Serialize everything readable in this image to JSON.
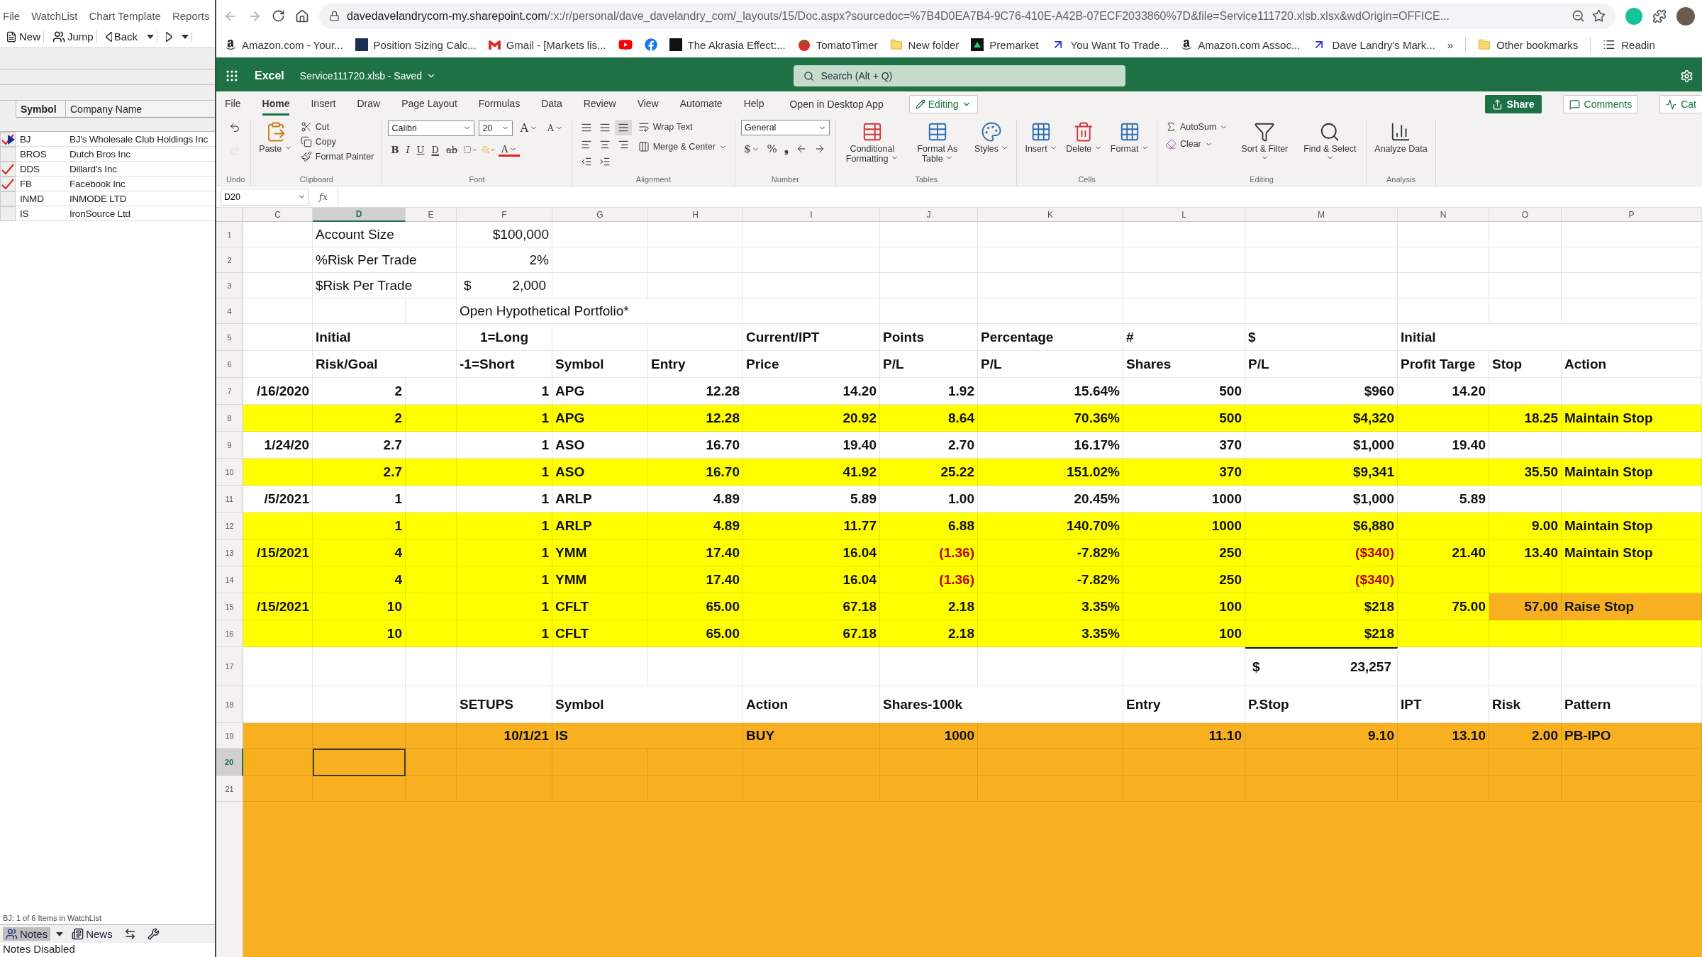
{
  "watchlist": {
    "menu": [
      "File",
      "WatchList",
      "Chart Template",
      "Reports"
    ],
    "toolbar": [
      {
        "kind": "new",
        "label": "New"
      },
      {
        "kind": "jump",
        "label": "Jump"
      },
      {
        "kind": "back",
        "label": "Back"
      },
      {
        "kind": "forward"
      }
    ],
    "columns": [
      "Symbol",
      "Company Name"
    ],
    "rows": [
      {
        "symbol": "BJ",
        "company": "BJ's Wholesale Club Holdings Inc",
        "checked": true,
        "selected": true
      },
      {
        "symbol": "BROS",
        "company": "Dutch Bros Inc",
        "checked": false,
        "selected": false
      },
      {
        "symbol": "DDS",
        "company": "Dillard's Inc",
        "checked": true,
        "selected": false
      },
      {
        "symbol": "FB",
        "company": "Facebook Inc",
        "checked": true,
        "selected": false
      },
      {
        "symbol": "INMD",
        "company": "INMODE LTD",
        "checked": false,
        "selected": false
      },
      {
        "symbol": "IS",
        "company": "IronSource Ltd",
        "checked": false,
        "selected": false
      }
    ],
    "status": "BJ: 1 of 6 Items in WatchList",
    "bottom_toolbar": [
      {
        "kind": "notes",
        "label": "Notes",
        "selected": true
      },
      {
        "kind": "news",
        "label": "News",
        "selected": false
      },
      {
        "kind": "swap",
        "selected": false
      },
      {
        "kind": "tool",
        "selected": false
      }
    ],
    "notes_message": "Notes Disabled"
  },
  "browser": {
    "url_host": "davedavelandrycom-my.sharepoint.com",
    "url_path": "/:x:/r/personal/dave_davelandry_com/_layouts/15/Doc.aspx?sourcedoc=%7B4D0EA7B4-9C76-410E-A42B-07ECF2033860%7D&file=Service111720.xlsb.xlsx&wdOrigin=OFFICE...",
    "bookmarks": [
      {
        "kind": "amazon",
        "label": "Amazon.com - Your..."
      },
      {
        "kind": "square",
        "label": "Position Sizing Calc..."
      },
      {
        "kind": "gmail",
        "label": "Gmail - [Markets lis..."
      },
      {
        "kind": "youtube"
      },
      {
        "kind": "facebook"
      },
      {
        "kind": "black",
        "label": "The Akrasia Effect:..."
      },
      {
        "kind": "tomato",
        "label": "TomatoTimer"
      },
      {
        "kind": "folder",
        "label": "New folder"
      },
      {
        "kind": "premarket",
        "label": "Premarket"
      },
      {
        "kind": "arrow",
        "label": "You Want To Trade..."
      },
      {
        "kind": "amazon",
        "label": "Amazon.com Assoc..."
      },
      {
        "kind": "arrow",
        "label": "Dave Landry's Mark..."
      }
    ],
    "more": "»",
    "other_bookmarks": "Other bookmarks",
    "reading_list": "Readin"
  },
  "excel": {
    "app": "Excel",
    "file": "Service111720.xlsb - Saved",
    "search_placeholder": "Search (Alt + Q)",
    "tabs": [
      {
        "label": "File",
        "selected": false
      },
      {
        "label": "Home",
        "selected": true
      },
      {
        "label": "Insert",
        "selected": false
      },
      {
        "label": "Draw",
        "selected": false
      },
      {
        "label": "Page Layout",
        "selected": false
      },
      {
        "label": "Formulas",
        "selected": false
      },
      {
        "label": "Data",
        "selected": false
      },
      {
        "label": "Review",
        "selected": false
      },
      {
        "label": "View",
        "selected": false
      },
      {
        "label": "Automate",
        "selected": false
      },
      {
        "label": "Help",
        "selected": false
      }
    ],
    "open_desktop": "Open in Desktop App",
    "mode": "Editing",
    "share": "Share",
    "comments": "Comments",
    "catch_up": "Cat",
    "groups": [
      {
        "label": "Undo",
        "controls": [
          {
            "kind": "icon",
            "disabled": false
          },
          {
            "kind": "icon",
            "disabled": true
          }
        ]
      },
      {
        "label": "Clipboard",
        "controls": [
          {
            "kind": "large",
            "label": "Paste"
          },
          {
            "kind": "small",
            "label": "Cut"
          },
          {
            "kind": "small",
            "label": "Copy"
          },
          {
            "kind": "small",
            "label": "Format Painter"
          }
        ]
      },
      {
        "label": "Font",
        "controls": [
          {
            "kind": "field",
            "value": "Calibri"
          },
          {
            "kind": "field",
            "value": "20"
          },
          {
            "kind": "glyph",
            "label": "A"
          },
          {
            "kind": "glyph",
            "label": "A"
          },
          {
            "kind": "glyph",
            "label": "B"
          },
          {
            "kind": "glyph",
            "label": "I"
          },
          {
            "kind": "glyph",
            "label": "U"
          },
          {
            "kind": "glyph",
            "label": "D"
          },
          {
            "kind": "glyph",
            "label": "ab"
          },
          {
            "kind": "icon"
          },
          {
            "kind": "icon"
          },
          {
            "kind": "glyph",
            "label": "A"
          }
        ]
      },
      {
        "label": "Alignment",
        "controls": [
          {
            "kind": "icon",
            "selected": false
          },
          {
            "kind": "icon",
            "selected": false
          },
          {
            "kind": "icon",
            "selected": true
          },
          {
            "kind": "icon"
          },
          {
            "kind": "icon"
          },
          {
            "kind": "icon"
          },
          {
            "kind": "icon"
          },
          {
            "kind": "icon"
          },
          {
            "kind": "small",
            "label": "Wrap Text"
          },
          {
            "kind": "small",
            "label": "Merge & Center"
          }
        ]
      },
      {
        "label": "Number",
        "controls": [
          {
            "kind": "field",
            "value": "General"
          },
          {
            "kind": "glyph",
            "label": "$"
          },
          {
            "kind": "glyph",
            "label": "%"
          },
          {
            "kind": "glyph",
            "label": "❟"
          },
          {
            "kind": "icon"
          },
          {
            "kind": "icon"
          }
        ]
      },
      {
        "label": "Tables",
        "controls": [
          {
            "kind": "large",
            "label": "Conditional Formatting"
          },
          {
            "kind": "large",
            "label": "Format As Table"
          },
          {
            "kind": "large",
            "label": "Styles"
          }
        ]
      },
      {
        "label": "Cells",
        "controls": [
          {
            "kind": "large",
            "label": "Insert"
          },
          {
            "kind": "large",
            "label": "Delete"
          },
          {
            "kind": "large",
            "label": "Format"
          }
        ]
      },
      {
        "label": "Editing",
        "controls": [
          {
            "kind": "small",
            "label": "AutoSum"
          },
          {
            "kind": "small",
            "label": "Clear"
          },
          {
            "kind": "large",
            "label": "Sort & Filter"
          },
          {
            "kind": "large",
            "label": "Find & Select"
          }
        ]
      },
      {
        "label": "Analysis",
        "controls": [
          {
            "kind": "large",
            "label": "Analyze Data"
          }
        ]
      }
    ],
    "name_box": "D20",
    "fx": "fx"
  },
  "sheet": {
    "columns": [
      {
        "letter": "C",
        "selected": false
      },
      {
        "letter": "D",
        "selected": true
      },
      {
        "letter": "E",
        "selected": false
      },
      {
        "letter": "F",
        "selected": false
      },
      {
        "letter": "G",
        "selected": false
      },
      {
        "letter": "H",
        "selected": false
      },
      {
        "letter": "I",
        "selected": false
      },
      {
        "letter": "J",
        "selected": false
      },
      {
        "letter": "K",
        "selected": false
      },
      {
        "letter": "L",
        "selected": false
      },
      {
        "letter": "M",
        "selected": false
      },
      {
        "letter": "N",
        "selected": false
      },
      {
        "letter": "O",
        "selected": false
      },
      {
        "letter": "P",
        "selected": false
      }
    ],
    "rows": [
      {
        "number": "1",
        "color": "#ffffff",
        "bold": false,
        "selected": false,
        "cells": [
          null,
          {
            "kind": "text",
            "text": "Account Size"
          },
          null,
          {
            "kind": "number",
            "text": "$100,000"
          },
          null,
          null,
          null,
          null,
          null,
          null,
          null,
          null,
          null,
          null
        ]
      },
      {
        "number": "2",
        "color": "#ffffff",
        "bold": false,
        "selected": false,
        "cells": [
          null,
          {
            "kind": "text",
            "text": "%Risk Per Trade"
          },
          null,
          {
            "kind": "number",
            "text": "2%"
          },
          null,
          null,
          null,
          null,
          null,
          null,
          null,
          null,
          null,
          null
        ]
      },
      {
        "number": "3",
        "color": "#ffffff",
        "bold": false,
        "selected": false,
        "cells": [
          null,
          {
            "kind": "text",
            "text": "$Risk Per Trade"
          },
          null,
          {
            "kind": "accounting",
            "symbol": "$",
            "text": "2,000"
          },
          null,
          null,
          null,
          null,
          null,
          null,
          null,
          null,
          null,
          null
        ]
      },
      {
        "number": "4",
        "color": "#ffffff",
        "bold": false,
        "selected": false,
        "cells": [
          null,
          null,
          null,
          {
            "kind": "text",
            "text": "Open Hypothetical Portfolio*"
          },
          null,
          null,
          null,
          null,
          null,
          null,
          null,
          null,
          null,
          null
        ]
      },
      {
        "number": "5",
        "color": "#ffffff",
        "bold": true,
        "selected": false,
        "cells": [
          null,
          {
            "kind": "text",
            "text": "Initial"
          },
          null,
          {
            "kind": "center",
            "text": "1=Long"
          },
          null,
          null,
          {
            "kind": "text",
            "text": "Current/IPT"
          },
          {
            "kind": "text",
            "text": "Points"
          },
          {
            "kind": "text",
            "text": "Percentage"
          },
          {
            "kind": "text",
            "text": "#"
          },
          {
            "kind": "text",
            "text": "$"
          },
          {
            "kind": "text",
            "text": "Initial"
          },
          null,
          null
        ]
      },
      {
        "number": "6",
        "color": "#ffffff",
        "bold": true,
        "selected": false,
        "cells": [
          null,
          {
            "kind": "text",
            "text": "Risk/Goal"
          },
          null,
          {
            "kind": "text",
            "text": "-1=Short"
          },
          {
            "kind": "text",
            "text": "Symbol"
          },
          {
            "kind": "text",
            "text": "Entry"
          },
          {
            "kind": "text",
            "text": "Price"
          },
          {
            "kind": "text",
            "text": "P/L"
          },
          {
            "kind": "text",
            "text": "P/L"
          },
          {
            "kind": "text",
            "text": "Shares"
          },
          {
            "kind": "text",
            "text": "P/L"
          },
          {
            "kind": "text",
            "text": "Profit Targe"
          },
          {
            "kind": "text",
            "text": "Stop"
          },
          {
            "kind": "text",
            "text": "Action"
          }
        ]
      },
      {
        "number": "7",
        "color": "#ffffff",
        "bold": true,
        "selected": false,
        "cells": [
          {
            "kind": "number",
            "text": "/16/2020"
          },
          {
            "kind": "number",
            "text": "2"
          },
          null,
          {
            "kind": "number",
            "text": "1"
          },
          {
            "kind": "text",
            "text": "APG"
          },
          {
            "kind": "number",
            "text": "12.28"
          },
          {
            "kind": "number",
            "text": "14.20"
          },
          {
            "kind": "number",
            "text": "1.92"
          },
          {
            "kind": "number",
            "text": "15.64%"
          },
          {
            "kind": "number",
            "text": "500"
          },
          {
            "kind": "number",
            "text": "$960"
          },
          {
            "kind": "number",
            "text": "14.20"
          },
          null,
          null
        ]
      },
      {
        "number": "8",
        "color": "#ffff00",
        "bold": true,
        "selected": false,
        "cells": [
          null,
          {
            "kind": "number",
            "text": "2"
          },
          null,
          {
            "kind": "number",
            "text": "1"
          },
          {
            "kind": "text",
            "text": "APG"
          },
          {
            "kind": "number",
            "text": "12.28"
          },
          {
            "kind": "number",
            "text": "20.92"
          },
          {
            "kind": "number",
            "text": "8.64"
          },
          {
            "kind": "number",
            "text": "70.36%"
          },
          {
            "kind": "number",
            "text": "500"
          },
          {
            "kind": "number",
            "text": "$4,320"
          },
          null,
          {
            "kind": "number",
            "text": "18.25"
          },
          {
            "kind": "text",
            "text": "Maintain Stop"
          }
        ]
      },
      {
        "number": "9",
        "color": "#ffffff",
        "bold": true,
        "selected": false,
        "cells": [
          {
            "kind": "number",
            "text": "1/24/20"
          },
          {
            "kind": "number",
            "text": "2.7"
          },
          null,
          {
            "kind": "number",
            "text": "1"
          },
          {
            "kind": "text",
            "text": "ASO"
          },
          {
            "kind": "number",
            "text": "16.70"
          },
          {
            "kind": "number",
            "text": "19.40"
          },
          {
            "kind": "number",
            "text": "2.70"
          },
          {
            "kind": "number",
            "text": "16.17%"
          },
          {
            "kind": "number",
            "text": "370"
          },
          {
            "kind": "number",
            "text": "$1,000"
          },
          {
            "kind": "number",
            "text": "19.40"
          },
          null,
          null
        ]
      },
      {
        "number": "10",
        "color": "#ffff00",
        "bold": true,
        "selected": false,
        "cells": [
          null,
          {
            "kind": "number",
            "text": "2.7"
          },
          null,
          {
            "kind": "number",
            "text": "1"
          },
          {
            "kind": "text",
            "text": "ASO"
          },
          {
            "kind": "number",
            "text": "16.70"
          },
          {
            "kind": "number",
            "text": "41.92"
          },
          {
            "kind": "number",
            "text": "25.22"
          },
          {
            "kind": "number",
            "text": "151.02%"
          },
          {
            "kind": "number",
            "text": "370"
          },
          {
            "kind": "number",
            "text": "$9,341"
          },
          null,
          {
            "kind": "number",
            "text": "35.50"
          },
          {
            "kind": "text",
            "text": "Maintain Stop"
          }
        ]
      },
      {
        "number": "11",
        "color": "#ffffff",
        "bold": true,
        "selected": false,
        "cells": [
          {
            "kind": "number",
            "text": "/5/2021"
          },
          {
            "kind": "number",
            "text": "1"
          },
          null,
          {
            "kind": "number",
            "text": "1"
          },
          {
            "kind": "text",
            "text": "ARLP"
          },
          {
            "kind": "number",
            "text": "4.89"
          },
          {
            "kind": "number",
            "text": "5.89"
          },
          {
            "kind": "number",
            "text": "1.00"
          },
          {
            "kind": "number",
            "text": "20.45%"
          },
          {
            "kind": "number",
            "text": "1000"
          },
          {
            "kind": "number",
            "text": "$1,000"
          },
          {
            "kind": "number",
            "text": "5.89"
          },
          null,
          null
        ]
      },
      {
        "number": "12",
        "color": "#ffff00",
        "bold": true,
        "selected": false,
        "cells": [
          null,
          {
            "kind": "number",
            "text": "1"
          },
          null,
          {
            "kind": "number",
            "text": "1"
          },
          {
            "kind": "text",
            "text": "ARLP"
          },
          {
            "kind": "number",
            "text": "4.89"
          },
          {
            "kind": "number",
            "text": "11.77"
          },
          {
            "kind": "number",
            "text": "6.88"
          },
          {
            "kind": "number",
            "text": "140.70%"
          },
          {
            "kind": "number",
            "text": "1000"
          },
          {
            "kind": "number",
            "text": "$6,880"
          },
          null,
          {
            "kind": "number",
            "text": "9.00"
          },
          {
            "kind": "text",
            "text": "Maintain Stop"
          }
        ]
      },
      {
        "number": "13",
        "color": "#ffff00",
        "bold": true,
        "selected": false,
        "cells": [
          {
            "kind": "number",
            "text": "/15/2021"
          },
          {
            "kind": "number",
            "text": "4"
          },
          null,
          {
            "kind": "number",
            "text": "1"
          },
          {
            "kind": "text",
            "text": "YMM"
          },
          {
            "kind": "number",
            "text": "17.40"
          },
          {
            "kind": "number",
            "text": "16.04"
          },
          {
            "kind": "negative",
            "text": "(1.36)"
          },
          {
            "kind": "number",
            "text": "-7.82%"
          },
          {
            "kind": "number",
            "text": "250"
          },
          {
            "kind": "negative",
            "text": "($340)"
          },
          {
            "kind": "number",
            "text": "21.40"
          },
          {
            "kind": "number",
            "text": "13.40"
          },
          {
            "kind": "text",
            "text": "Maintain Stop"
          }
        ]
      },
      {
        "number": "14",
        "color": "#ffff00",
        "bold": true,
        "selected": false,
        "cells": [
          null,
          {
            "kind": "number",
            "text": "4"
          },
          null,
          {
            "kind": "number",
            "text": "1"
          },
          {
            "kind": "text",
            "text": "YMM"
          },
          {
            "kind": "number",
            "text": "17.40"
          },
          {
            "kind": "number",
            "text": "16.04"
          },
          {
            "kind": "negative",
            "text": "(1.36)"
          },
          {
            "kind": "number",
            "text": "-7.82%"
          },
          {
            "kind": "number",
            "text": "250"
          },
          {
            "kind": "negative",
            "text": "($340)"
          },
          null,
          null,
          null
        ]
      },
      {
        "number": "15",
        "color": "#ffff00",
        "bold": true,
        "selected": false,
        "cells": [
          {
            "kind": "number",
            "text": "/15/2021"
          },
          {
            "kind": "number",
            "text": "10"
          },
          null,
          {
            "kind": "number",
            "text": "1"
          },
          {
            "kind": "text",
            "text": "CFLT"
          },
          {
            "kind": "number",
            "text": "65.00"
          },
          {
            "kind": "number",
            "text": "67.18"
          },
          {
            "kind": "number",
            "text": "2.18"
          },
          {
            "kind": "number",
            "text": "3.35%"
          },
          {
            "kind": "number",
            "text": "100"
          },
          {
            "kind": "number",
            "text": "$218"
          },
          {
            "kind": "number",
            "text": "75.00"
          },
          {
            "kind": "number",
            "text": "57.00",
            "color": "#f8b020"
          },
          {
            "kind": "text",
            "text": "Raise Stop",
            "color": "#f8b020"
          }
        ]
      },
      {
        "number": "16",
        "color": "#ffff00",
        "bold": true,
        "selected": false,
        "cells": [
          null,
          {
            "kind": "number",
            "text": "10"
          },
          null,
          {
            "kind": "number",
            "text": "1"
          },
          {
            "kind": "text",
            "text": "CFLT"
          },
          {
            "kind": "number",
            "text": "65.00"
          },
          {
            "kind": "number",
            "text": "67.18"
          },
          {
            "kind": "number",
            "text": "2.18"
          },
          {
            "kind": "number",
            "text": "3.35%"
          },
          {
            "kind": "number",
            "text": "100"
          },
          {
            "kind": "number",
            "text": "$218"
          },
          null,
          null,
          null
        ]
      },
      {
        "number": "17",
        "color": "#ffffff",
        "bold": true,
        "selected": false,
        "cells": [
          null,
          null,
          null,
          null,
          null,
          null,
          null,
          null,
          null,
          null,
          {
            "kind": "total",
            "symbol": "$",
            "text": "23,257"
          },
          null,
          null,
          null
        ]
      },
      {
        "number": "18",
        "color": "#ffffff",
        "bold": true,
        "selected": false,
        "cells": [
          null,
          null,
          null,
          {
            "kind": "text",
            "text": "SETUPS"
          },
          {
            "kind": "text",
            "text": "Symbol"
          },
          null,
          {
            "kind": "text",
            "text": "Action"
          },
          {
            "kind": "text",
            "text": "Shares-100k"
          },
          null,
          {
            "kind": "text",
            "text": "Entry"
          },
          {
            "kind": "text",
            "text": "P.Stop"
          },
          {
            "kind": "text",
            "text": "IPT"
          },
          {
            "kind": "text",
            "text": "Risk"
          },
          {
            "kind": "text",
            "text": "Pattern"
          }
        ]
      },
      {
        "number": "19",
        "color": "#f8b020",
        "bold": true,
        "selected": false,
        "cells": [
          null,
          null,
          null,
          {
            "kind": "number",
            "text": "10/1/21"
          },
          {
            "kind": "text",
            "text": "IS"
          },
          null,
          {
            "kind": "text",
            "text": "BUY"
          },
          {
            "kind": "number",
            "text": "1000"
          },
          null,
          {
            "kind": "number",
            "text": "11.10"
          },
          {
            "kind": "number",
            "text": "9.10"
          },
          {
            "kind": "number",
            "text": "13.10"
          },
          {
            "kind": "number",
            "text": "2.00"
          },
          {
            "kind": "text",
            "text": "PB-IPO"
          }
        ]
      },
      {
        "number": "20",
        "color": "#f8b020",
        "selected": true,
        "cells": [
          null,
          null,
          null,
          null,
          null,
          null,
          null,
          null,
          null,
          null,
          null,
          null,
          null,
          null
        ]
      },
      {
        "number": "21",
        "color": "#f8b020",
        "selected": false,
        "cells": [
          null,
          null,
          null,
          null,
          null,
          null,
          null,
          null,
          null,
          null,
          null,
          null,
          null,
          null
        ]
      }
    ]
  }
}
